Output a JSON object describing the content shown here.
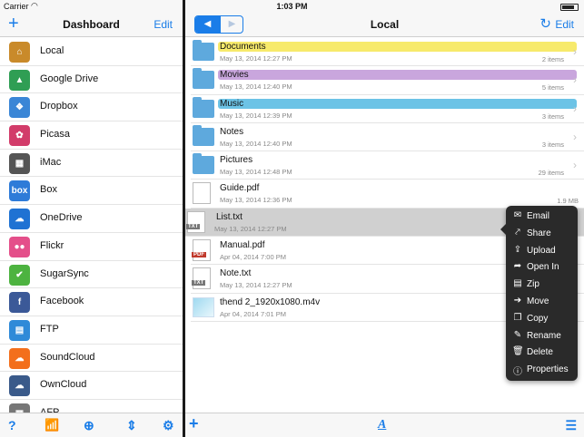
{
  "status": {
    "carrier": "Carrier",
    "time": "1:03 PM"
  },
  "left": {
    "title": "Dashboard",
    "add_label": "+",
    "edit_label": "Edit",
    "services": [
      {
        "label": "Local",
        "icon": "local-icon",
        "color": "#c98a2a",
        "glyph": "⌂"
      },
      {
        "label": "Google Drive",
        "icon": "google-drive-icon",
        "color": "#2f9e54",
        "glyph": "▲"
      },
      {
        "label": "Dropbox",
        "icon": "dropbox-icon",
        "color": "#3a86d6",
        "glyph": "❖"
      },
      {
        "label": "Picasa",
        "icon": "picasa-icon",
        "color": "#d23c6a",
        "glyph": "✿"
      },
      {
        "label": "iMac",
        "icon": "imac-icon",
        "color": "#555555",
        "glyph": "▦"
      },
      {
        "label": "Box",
        "icon": "box-icon",
        "color": "#2e7bd8",
        "glyph": "box"
      },
      {
        "label": "OneDrive",
        "icon": "onedrive-icon",
        "color": "#1f72d3",
        "glyph": "☁"
      },
      {
        "label": "Flickr",
        "icon": "flickr-icon",
        "color": "#e44f8a",
        "glyph": "●●"
      },
      {
        "label": "SugarSync",
        "icon": "sugarsync-icon",
        "color": "#4db340",
        "glyph": "✔"
      },
      {
        "label": "Facebook",
        "icon": "facebook-icon",
        "color": "#3b5998",
        "glyph": "f"
      },
      {
        "label": "FTP",
        "icon": "ftp-icon",
        "color": "#2f8ad8",
        "glyph": "▤"
      },
      {
        "label": "SoundCloud",
        "icon": "soundcloud-icon",
        "color": "#f36f1c",
        "glyph": "☁"
      },
      {
        "label": "OwnCloud",
        "icon": "owncloud-icon",
        "color": "#3a5a8a",
        "glyph": "☁"
      },
      {
        "label": "AFP",
        "icon": "afp-icon",
        "color": "#777777",
        "glyph": "▦"
      }
    ],
    "toolbar": {
      "help": "?",
      "wifi": "wifi-icon",
      "globe": "globe-icon",
      "sort": "sort-icon",
      "settings": "gear-icon"
    }
  },
  "right": {
    "title": "Local",
    "back_glyph": "◀",
    "forward_glyph": "▶",
    "refresh_glyph": "↻",
    "edit_label": "Edit",
    "files": [
      {
        "name": "Documents",
        "date": "May 13, 2014 12:27 PM",
        "meta": "2 items",
        "kind": "folder",
        "highlight": "#f7ea6b",
        "chevron": true
      },
      {
        "name": "Movies",
        "date": "May 13, 2014 12:40 PM",
        "meta": "5 items",
        "kind": "folder",
        "highlight": "#c9a6dd",
        "chevron": true
      },
      {
        "name": "Music",
        "date": "May 13, 2014 12:39 PM",
        "meta": "3 items",
        "kind": "folder",
        "highlight": "#6cc3e6",
        "chevron": true
      },
      {
        "name": "Notes",
        "date": "May 13, 2014 12:40 PM",
        "meta": "3 items",
        "kind": "folder",
        "highlight": "",
        "chevron": true
      },
      {
        "name": "Pictures",
        "date": "May 13, 2014 12:48 PM",
        "meta": "29 items",
        "kind": "folder",
        "highlight": "",
        "chevron": true
      },
      {
        "name": "Guide.pdf",
        "date": "May 13, 2014 12:36 PM",
        "meta": "1.9 MB",
        "kind": "guide",
        "highlight": "",
        "chevron": false
      },
      {
        "name": "List.txt",
        "date": "May 13, 2014 12:27 PM",
        "meta": "",
        "kind": "txt",
        "highlight": "",
        "chevron": false,
        "selected": true
      },
      {
        "name": "Manual.pdf",
        "date": "Apr 04, 2014 7:00 PM",
        "meta": "",
        "kind": "pdf",
        "highlight": "",
        "chevron": false
      },
      {
        "name": "Note.txt",
        "date": "May 13, 2014 12:27 PM",
        "meta": "",
        "kind": "txt",
        "highlight": "",
        "chevron": false
      },
      {
        "name": "thend 2_1920x1080.m4v",
        "date": "Apr 04, 2014 7:01 PM",
        "meta": "",
        "kind": "video",
        "highlight": "",
        "chevron": false
      }
    ],
    "txt_tag": "TXT",
    "pdf_tag": "PDF",
    "toolbar": {
      "add": "+",
      "font": "A",
      "menu": "menu-icon"
    }
  },
  "context_menu": [
    {
      "label": "Email",
      "icon": "email-icon",
      "glyph": "✉"
    },
    {
      "label": "Share",
      "icon": "share-icon",
      "glyph": "⤤"
    },
    {
      "label": "Upload",
      "icon": "upload-icon",
      "glyph": "⇪"
    },
    {
      "label": "Open In",
      "icon": "open-in-icon",
      "glyph": "➦"
    },
    {
      "label": "Zip",
      "icon": "zip-icon",
      "glyph": "▤"
    },
    {
      "label": "Move",
      "icon": "move-icon",
      "glyph": "➔"
    },
    {
      "label": "Copy",
      "icon": "copy-icon",
      "glyph": "❐"
    },
    {
      "label": "Rename",
      "icon": "rename-icon",
      "glyph": "✎"
    },
    {
      "label": "Delete",
      "icon": "delete-icon",
      "glyph": "🗑"
    },
    {
      "label": "Properties",
      "icon": "info-icon",
      "glyph": "ⓘ"
    }
  ]
}
